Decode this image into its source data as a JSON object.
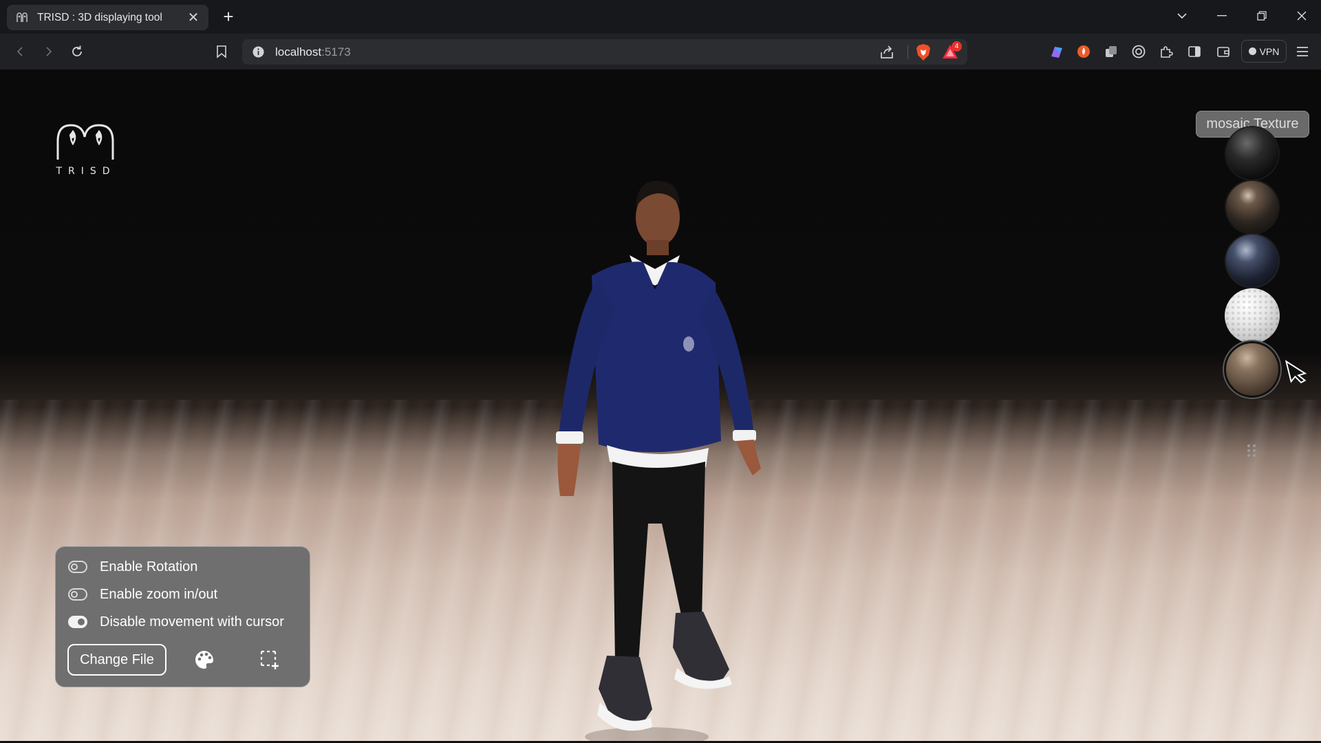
{
  "browser": {
    "tab_title": "TRISD : 3D displaying tool",
    "tab_close": "✕",
    "new_tab": "+",
    "url_host": "localhost",
    "url_port": ":5173",
    "rewards_badge": "4",
    "vpn_label": "VPN"
  },
  "app": {
    "logo_text": "TRISD",
    "texture_label": "mosaic Texture",
    "textures": [
      "black-glossy",
      "dark-wood-marble",
      "blue-black-marble",
      "white-mosaic",
      "brown-stone"
    ],
    "selected_texture": "brown-stone",
    "options": [
      {
        "label": "Enable Rotation",
        "state": "off"
      },
      {
        "label": "Enable zoom in/out",
        "state": "off"
      },
      {
        "label": "Disable movement with cursor",
        "state": "on"
      }
    ],
    "change_file_label": "Change File",
    "icons": {
      "palette": "palette-icon",
      "screenshot": "select-area-add-icon"
    }
  },
  "colors": {
    "panel_bg": "#6f6f6f",
    "tab_bg": "#2c2d31",
    "toolbar_bg": "#202124"
  }
}
